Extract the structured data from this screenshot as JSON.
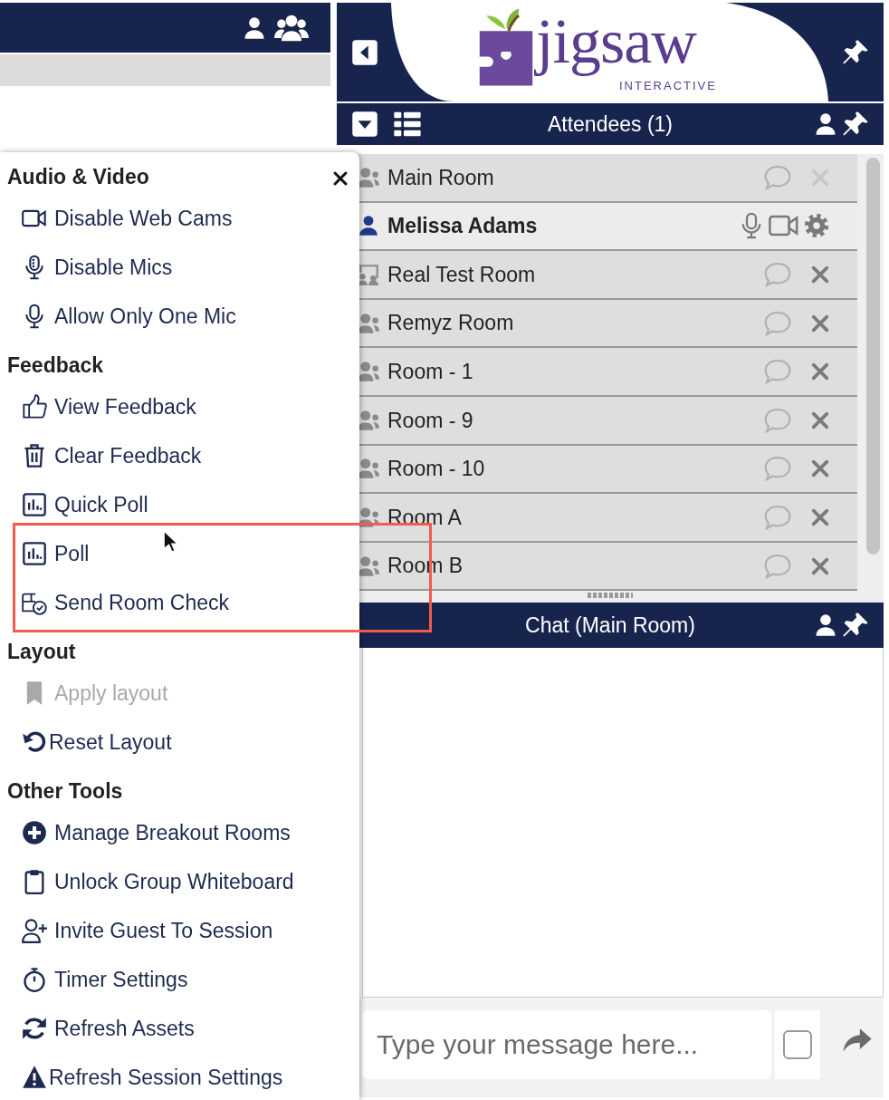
{
  "logo": {
    "name": "jigsaw",
    "tagline": "INTERACTIVE"
  },
  "attendees": {
    "title": "Attendees (1)",
    "rows": [
      {
        "kind": "room",
        "name": "Main Room",
        "selected": false,
        "remove_disabled": true
      },
      {
        "kind": "user",
        "name": "Melissa Adams",
        "selected": true
      },
      {
        "kind": "presenter_room",
        "name": "Real Test Room",
        "selected": false,
        "remove_disabled": false
      },
      {
        "kind": "room",
        "name": "Remyz Room",
        "selected": false,
        "remove_disabled": false
      },
      {
        "kind": "room",
        "name": "Room - 1",
        "selected": false,
        "remove_disabled": false
      },
      {
        "kind": "room",
        "name": "Room - 9",
        "selected": false,
        "remove_disabled": false
      },
      {
        "kind": "room",
        "name": "Room - 10",
        "selected": false,
        "remove_disabled": false
      },
      {
        "kind": "room",
        "name": "Room A",
        "selected": false,
        "remove_disabled": false
      },
      {
        "kind": "room",
        "name": "Room B",
        "selected": false,
        "remove_disabled": false
      }
    ]
  },
  "chat": {
    "title": "Chat (Main Room)",
    "placeholder": "Type your message here...",
    "checked": false
  },
  "menu": {
    "sections": [
      {
        "title": "Audio & Video",
        "items": [
          {
            "label": "Disable Web Cams",
            "disabled": false
          },
          {
            "label": "Disable Mics",
            "disabled": false
          },
          {
            "label": "Allow Only One Mic",
            "disabled": false
          }
        ]
      },
      {
        "title": "Feedback",
        "items": [
          {
            "label": "View Feedback",
            "disabled": false
          },
          {
            "label": "Clear Feedback",
            "disabled": false
          },
          {
            "label": "Quick Poll",
            "disabled": false
          },
          {
            "label": "Poll",
            "disabled": false
          },
          {
            "label": "Send Room Check",
            "disabled": false
          }
        ]
      },
      {
        "title": "Layout",
        "items": [
          {
            "label": "Apply layout",
            "disabled": true
          },
          {
            "label": "Reset Layout",
            "disabled": false
          }
        ]
      },
      {
        "title": "Other Tools",
        "items": [
          {
            "label": "Manage Breakout Rooms",
            "disabled": false
          },
          {
            "label": "Unlock Group Whiteboard",
            "disabled": false
          },
          {
            "label": "Invite Guest To Session",
            "disabled": false
          },
          {
            "label": "Timer Settings",
            "disabled": false
          },
          {
            "label": "Refresh Assets",
            "disabled": false
          },
          {
            "label": "Refresh Session Settings",
            "disabled": false
          }
        ]
      }
    ]
  }
}
